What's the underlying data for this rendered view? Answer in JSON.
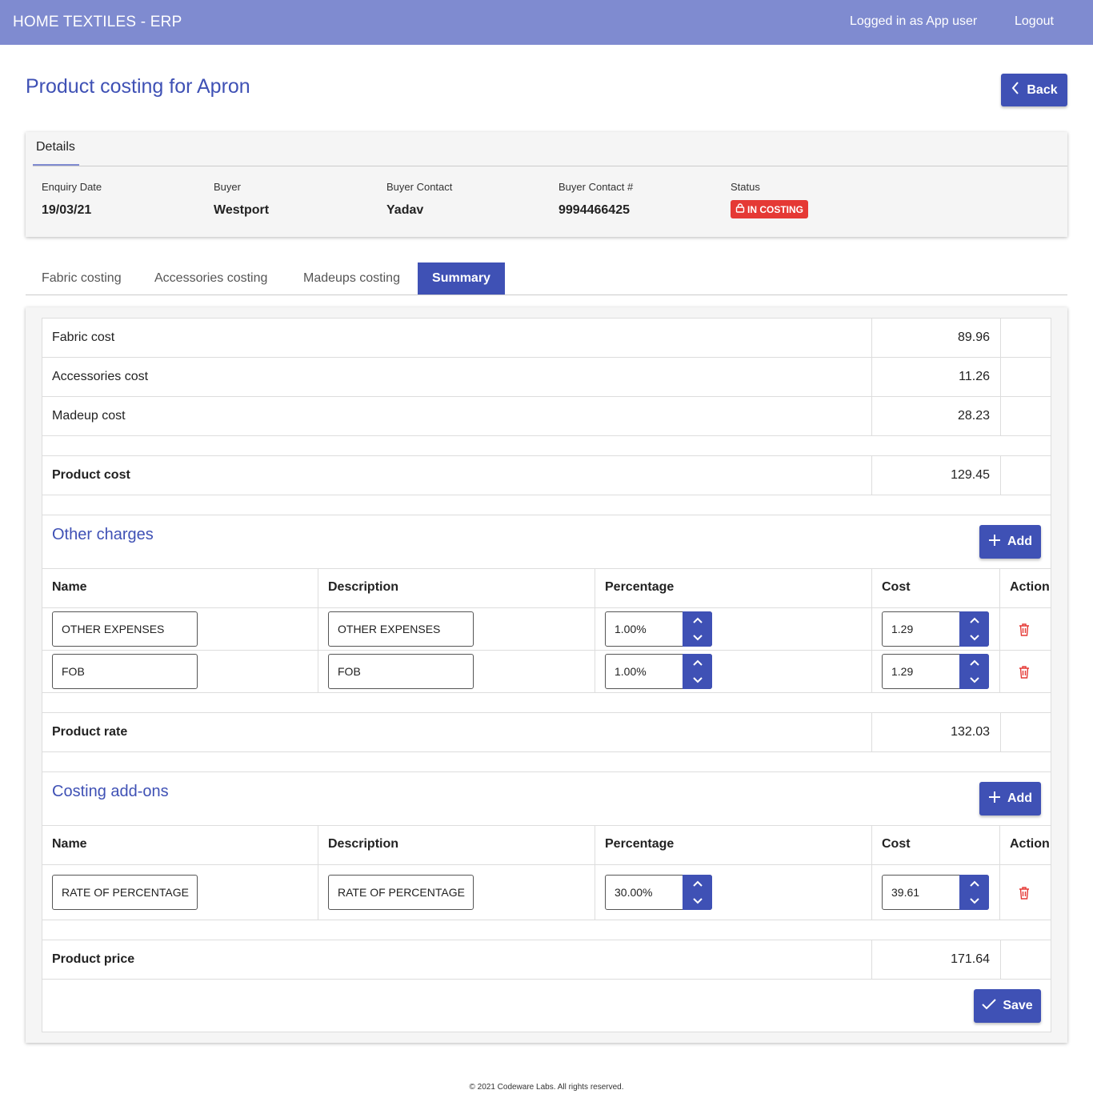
{
  "app": {
    "title": "HOME TEXTILES - ERP",
    "user_text": "Logged in as App user",
    "logout_label": "Logout"
  },
  "page": {
    "title": "Product costing for Apron",
    "back_label": "Back"
  },
  "details": {
    "tab_label": "Details",
    "fields": [
      {
        "label": "Enquiry Date",
        "value": "19/03/21"
      },
      {
        "label": "Buyer",
        "value": "Westport"
      },
      {
        "label": "Buyer Contact",
        "value": "Yadav"
      },
      {
        "label": "Buyer Contact #",
        "value": "9994466425"
      }
    ],
    "status_label": "Status",
    "status_value": "IN COSTING",
    "status_color": "#e53935"
  },
  "tabs": [
    "Fabric costing",
    "Accessories costing",
    "Madeups costing",
    "Summary"
  ],
  "active_tab": "Summary",
  "summary": {
    "fabric": {
      "label": "Fabric cost",
      "value": "89.96"
    },
    "accessories": {
      "label": "Accessories cost",
      "value": "11.26"
    },
    "madeup": {
      "label": "Madeup cost",
      "value": "28.23"
    },
    "product_cost": {
      "label": "Product cost",
      "value": "129.45"
    },
    "other_charges": {
      "title": "Other charges",
      "add_label": "Add",
      "headers": [
        "Name",
        "Description",
        "Percentage",
        "Cost",
        "Action"
      ],
      "rows": [
        {
          "name": "OTHER EXPENSES",
          "description": "OTHER EXPENSES",
          "percentage": "1.00%",
          "cost": "1.29"
        },
        {
          "name": "FOB",
          "description": "FOB",
          "percentage": "1.00%",
          "cost": "1.29"
        }
      ]
    },
    "product_rate": {
      "label": "Product rate",
      "value": "132.03"
    },
    "addons": {
      "title": "Costing add-ons",
      "add_label": "Add",
      "headers": [
        "Name",
        "Description",
        "Percentage",
        "Cost",
        "Action"
      ],
      "rows": [
        {
          "name": "RATE OF PERCENTAGE",
          "description": "RATE OF PERCENTAGE",
          "percentage": "30.00%",
          "cost": "39.61"
        }
      ]
    },
    "product_price": {
      "label": "Product price",
      "value": "171.64"
    },
    "save_label": "Save"
  },
  "footer": "© 2021 Codeware Labs. All rights reserved.",
  "colors": {
    "topbar": "#7f8bd0",
    "primary": "#3f51b5",
    "danger": "#e53935"
  }
}
